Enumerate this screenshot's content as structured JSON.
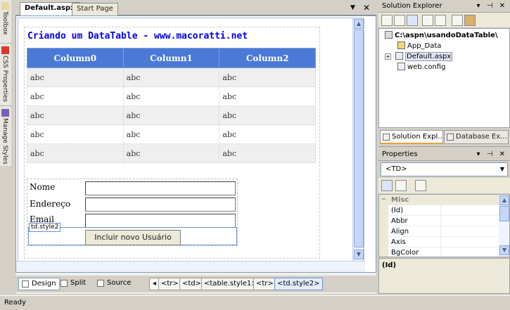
{
  "left_strip": {
    "tabs": [
      {
        "label": "Toolbox",
        "icon": "toolbox-icon"
      },
      {
        "label": "CSS Properties",
        "icon": "css-properties-icon"
      },
      {
        "label": "Manage Styles",
        "icon": "manage-styles-icon"
      }
    ]
  },
  "document": {
    "tabs": [
      {
        "label": "Default.aspx",
        "active": true
      },
      {
        "label": "Start Page",
        "active": false
      }
    ],
    "controls": {
      "dropdown": "▼",
      "close": "✕"
    },
    "page_title": "Criando um DataTable - www.macoratti.net",
    "grid": {
      "columns": [
        "Column0",
        "Column1",
        "Column2"
      ],
      "rows": [
        [
          "abc",
          "abc",
          "abc"
        ],
        [
          "abc",
          "abc",
          "abc"
        ],
        [
          "abc",
          "abc",
          "abc"
        ],
        [
          "abc",
          "abc",
          "abc"
        ],
        [
          "abc",
          "abc",
          "abc"
        ]
      ],
      "header_color": "#4b79d6",
      "alt_row_color": "#efefef"
    },
    "form": {
      "labels": [
        "Nome",
        "Endereço",
        "Email"
      ],
      "button_label": "Incluir novo Usuário",
      "selected_tag": "td.style2"
    },
    "views": [
      {
        "label": "Design",
        "active": true,
        "icon": "design-view-icon"
      },
      {
        "label": "Split",
        "active": false,
        "icon": "split-view-icon"
      },
      {
        "label": "Source",
        "active": false,
        "icon": "source-view-icon"
      }
    ],
    "breadcrumb_nav_left": "◂",
    "breadcrumbs": [
      "<tr>",
      "<td>",
      "<table.style1>",
      "<tr>",
      "<td.style2>"
    ]
  },
  "solution_explorer": {
    "title": "Solution Explorer",
    "controls": "▾ ⊣ ✕",
    "root": "C:\\aspn\\usandoDataTable\\",
    "items": [
      {
        "label": "App_Data",
        "icon": "folder-icon"
      },
      {
        "label": "Default.aspx",
        "icon": "aspx-page-icon",
        "expander": "+"
      },
      {
        "label": "web.config",
        "icon": "config-file-icon"
      }
    ],
    "bottom_tabs": [
      {
        "label": "Solution Expl...",
        "active": true
      },
      {
        "label": "Database Ex...",
        "active": false
      }
    ]
  },
  "properties": {
    "title": "Properties",
    "controls": "▾ ⊣ ✕",
    "selected_object": "<TD>",
    "category": "Misc",
    "rows": [
      "(Id)",
      "Abbr",
      "Align",
      "Axis",
      "BgColor"
    ],
    "description_title": "(Id)"
  },
  "status": "Ready"
}
